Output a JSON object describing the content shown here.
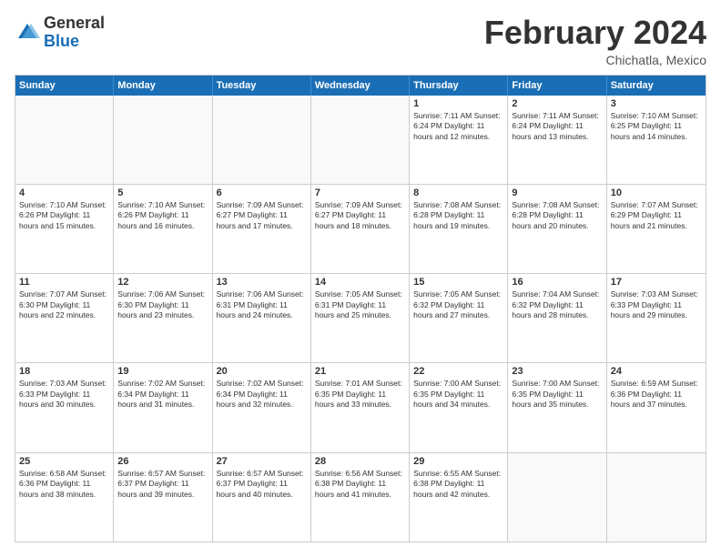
{
  "header": {
    "logo_general": "General",
    "logo_blue": "Blue",
    "month_title": "February 2024",
    "subtitle": "Chichatla, Mexico"
  },
  "days_of_week": [
    "Sunday",
    "Monday",
    "Tuesday",
    "Wednesday",
    "Thursday",
    "Friday",
    "Saturday"
  ],
  "weeks": [
    [
      {
        "day": "",
        "info": "",
        "empty": true
      },
      {
        "day": "",
        "info": "",
        "empty": true
      },
      {
        "day": "",
        "info": "",
        "empty": true
      },
      {
        "day": "",
        "info": "",
        "empty": true
      },
      {
        "day": "1",
        "info": "Sunrise: 7:11 AM\nSunset: 6:24 PM\nDaylight: 11 hours and 12 minutes."
      },
      {
        "day": "2",
        "info": "Sunrise: 7:11 AM\nSunset: 6:24 PM\nDaylight: 11 hours and 13 minutes."
      },
      {
        "day": "3",
        "info": "Sunrise: 7:10 AM\nSunset: 6:25 PM\nDaylight: 11 hours and 14 minutes."
      }
    ],
    [
      {
        "day": "4",
        "info": "Sunrise: 7:10 AM\nSunset: 6:26 PM\nDaylight: 11 hours and 15 minutes."
      },
      {
        "day": "5",
        "info": "Sunrise: 7:10 AM\nSunset: 6:26 PM\nDaylight: 11 hours and 16 minutes."
      },
      {
        "day": "6",
        "info": "Sunrise: 7:09 AM\nSunset: 6:27 PM\nDaylight: 11 hours and 17 minutes."
      },
      {
        "day": "7",
        "info": "Sunrise: 7:09 AM\nSunset: 6:27 PM\nDaylight: 11 hours and 18 minutes."
      },
      {
        "day": "8",
        "info": "Sunrise: 7:08 AM\nSunset: 6:28 PM\nDaylight: 11 hours and 19 minutes."
      },
      {
        "day": "9",
        "info": "Sunrise: 7:08 AM\nSunset: 6:28 PM\nDaylight: 11 hours and 20 minutes."
      },
      {
        "day": "10",
        "info": "Sunrise: 7:07 AM\nSunset: 6:29 PM\nDaylight: 11 hours and 21 minutes."
      }
    ],
    [
      {
        "day": "11",
        "info": "Sunrise: 7:07 AM\nSunset: 6:30 PM\nDaylight: 11 hours and 22 minutes."
      },
      {
        "day": "12",
        "info": "Sunrise: 7:06 AM\nSunset: 6:30 PM\nDaylight: 11 hours and 23 minutes."
      },
      {
        "day": "13",
        "info": "Sunrise: 7:06 AM\nSunset: 6:31 PM\nDaylight: 11 hours and 24 minutes."
      },
      {
        "day": "14",
        "info": "Sunrise: 7:05 AM\nSunset: 6:31 PM\nDaylight: 11 hours and 25 minutes."
      },
      {
        "day": "15",
        "info": "Sunrise: 7:05 AM\nSunset: 6:32 PM\nDaylight: 11 hours and 27 minutes."
      },
      {
        "day": "16",
        "info": "Sunrise: 7:04 AM\nSunset: 6:32 PM\nDaylight: 11 hours and 28 minutes."
      },
      {
        "day": "17",
        "info": "Sunrise: 7:03 AM\nSunset: 6:33 PM\nDaylight: 11 hours and 29 minutes."
      }
    ],
    [
      {
        "day": "18",
        "info": "Sunrise: 7:03 AM\nSunset: 6:33 PM\nDaylight: 11 hours and 30 minutes."
      },
      {
        "day": "19",
        "info": "Sunrise: 7:02 AM\nSunset: 6:34 PM\nDaylight: 11 hours and 31 minutes."
      },
      {
        "day": "20",
        "info": "Sunrise: 7:02 AM\nSunset: 6:34 PM\nDaylight: 11 hours and 32 minutes."
      },
      {
        "day": "21",
        "info": "Sunrise: 7:01 AM\nSunset: 6:35 PM\nDaylight: 11 hours and 33 minutes."
      },
      {
        "day": "22",
        "info": "Sunrise: 7:00 AM\nSunset: 6:35 PM\nDaylight: 11 hours and 34 minutes."
      },
      {
        "day": "23",
        "info": "Sunrise: 7:00 AM\nSunset: 6:35 PM\nDaylight: 11 hours and 35 minutes."
      },
      {
        "day": "24",
        "info": "Sunrise: 6:59 AM\nSunset: 6:36 PM\nDaylight: 11 hours and 37 minutes."
      }
    ],
    [
      {
        "day": "25",
        "info": "Sunrise: 6:58 AM\nSunset: 6:36 PM\nDaylight: 11 hours and 38 minutes."
      },
      {
        "day": "26",
        "info": "Sunrise: 6:57 AM\nSunset: 6:37 PM\nDaylight: 11 hours and 39 minutes."
      },
      {
        "day": "27",
        "info": "Sunrise: 6:57 AM\nSunset: 6:37 PM\nDaylight: 11 hours and 40 minutes."
      },
      {
        "day": "28",
        "info": "Sunrise: 6:56 AM\nSunset: 6:38 PM\nDaylight: 11 hours and 41 minutes."
      },
      {
        "day": "29",
        "info": "Sunrise: 6:55 AM\nSunset: 6:38 PM\nDaylight: 11 hours and 42 minutes."
      },
      {
        "day": "",
        "info": "",
        "empty": true
      },
      {
        "day": "",
        "info": "",
        "empty": true
      }
    ]
  ]
}
